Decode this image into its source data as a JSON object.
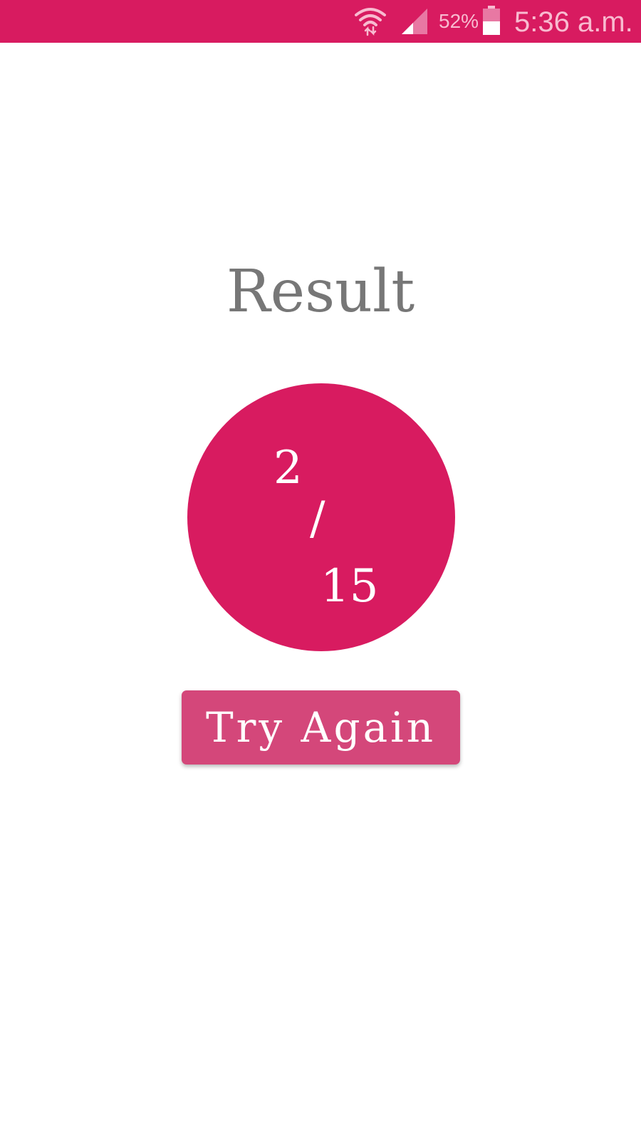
{
  "status_bar": {
    "background_color": "#d81b60",
    "icons": [
      "wifi-icon",
      "signal-icon",
      "battery-icon"
    ],
    "battery_percent": "52%",
    "time": "5:36 a.m."
  },
  "result": {
    "title": "Result",
    "score": "2",
    "separator": "/",
    "total": "15",
    "circle_color": "#d81b60"
  },
  "actions": {
    "try_again_label": "Try Again",
    "button_color": "#d4477a"
  }
}
